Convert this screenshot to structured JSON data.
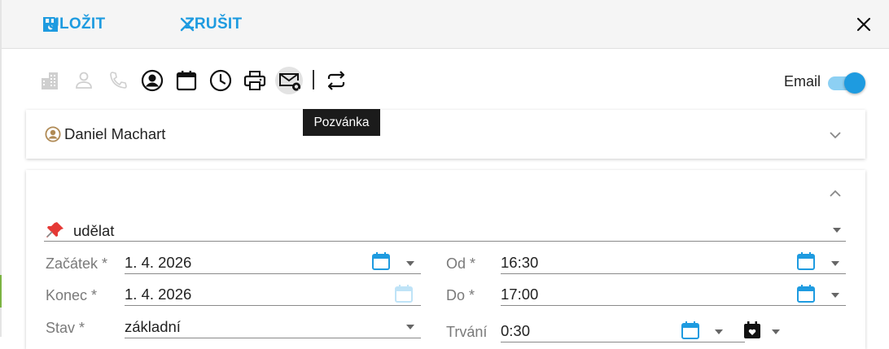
{
  "header": {
    "save_label": "ULOŽIT",
    "cancel_label": "ZRUŠIT"
  },
  "toolbar": {
    "icons": [
      "building-icon",
      "person-icon",
      "phone-icon",
      "account-circle-icon",
      "calendar-icon",
      "clock-icon",
      "print-icon",
      "email-invite-icon",
      "repeat-icon"
    ],
    "email_label": "Email",
    "email_toggle_on": true,
    "tooltip": "Pozvánka"
  },
  "contact": {
    "name": "Daniel Machart"
  },
  "form": {
    "type_value": "udělat",
    "start_label": "Začátek *",
    "start_date": "1. 4. 2026",
    "from_label": "Od *",
    "from_time": "16:30",
    "end_label": "Konec *",
    "end_date": "1. 4. 2026",
    "to_label": "Do *",
    "to_time": "17:00",
    "status_label": "Stav *",
    "status_value": "základní",
    "duration_label": "Trvání",
    "duration_value": "0:30"
  },
  "colors": {
    "accent": "#1e9be0",
    "toggle_track": "#8dd0f3",
    "header_bg": "#f5f5f5",
    "tooltip_bg": "#1b1b1b"
  }
}
